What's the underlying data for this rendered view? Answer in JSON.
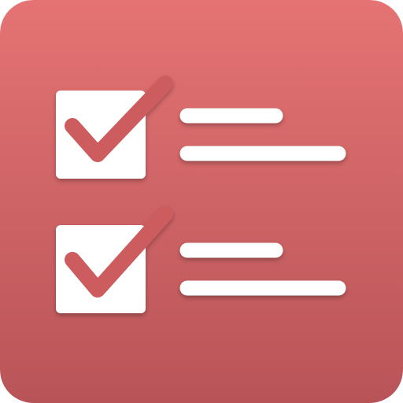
{
  "icon": {
    "name": "checklist-app-icon",
    "background_top": "#e57373",
    "background_bottom": "#b85458",
    "box_color": "#ffffff",
    "check_color": "#cd5c5f",
    "line_color": "#ffffff"
  },
  "checklist": {
    "items": [
      {
        "checked": true
      },
      {
        "checked": true
      }
    ]
  }
}
